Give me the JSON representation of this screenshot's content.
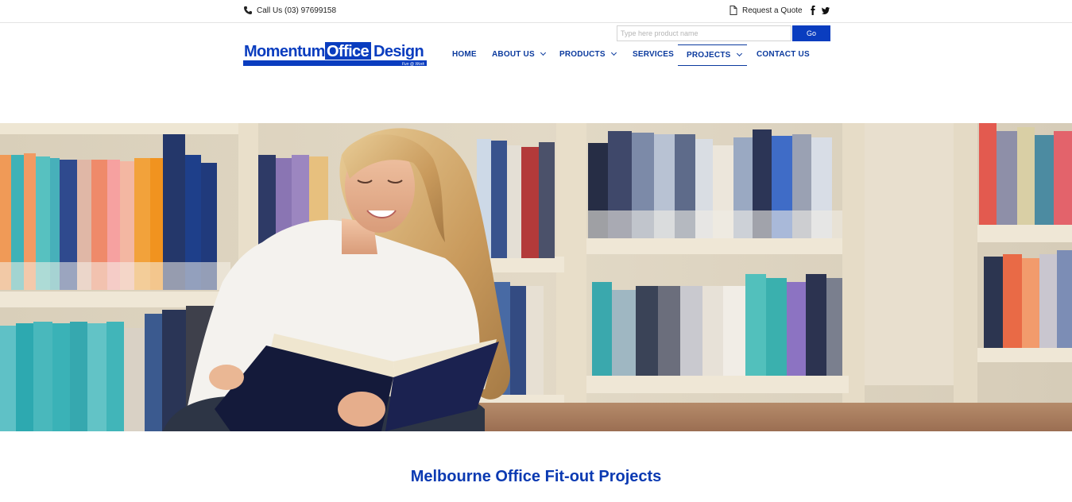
{
  "topbar": {
    "call_text": "Call Us (03) 97699158",
    "quote_text": "Request a Quote",
    "social": [
      "facebook-icon",
      "twitter-icon"
    ]
  },
  "search": {
    "placeholder": "Type here product name",
    "value": "",
    "button_label": "Go"
  },
  "logo": {
    "word1": "Momentum",
    "word2": "Office",
    "word3": "Design",
    "tagline": "Fun @ Work",
    "brand_color": "#0a3dbf"
  },
  "nav": {
    "items": [
      {
        "label": "HOME",
        "has_dropdown": false,
        "active": false
      },
      {
        "label": "ABOUT US",
        "has_dropdown": true,
        "active": false
      },
      {
        "label": "PRODUCTS",
        "has_dropdown": true,
        "active": false
      },
      {
        "label": "SERVICES",
        "has_dropdown": false,
        "active": false
      },
      {
        "label": "PROJECTS",
        "has_dropdown": true,
        "active": true
      },
      {
        "label": "CONTACT US",
        "has_dropdown": false,
        "active": false
      }
    ]
  },
  "hero": {
    "image_subject": "woman reading a book in a library"
  },
  "page": {
    "title": "Melbourne Office Fit-out Projects"
  }
}
